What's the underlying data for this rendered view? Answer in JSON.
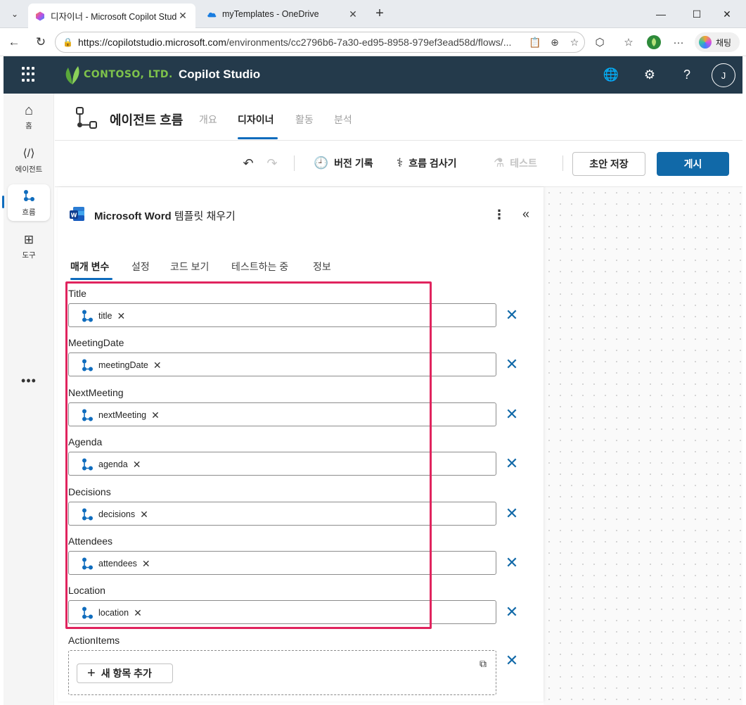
{
  "browser": {
    "tabs": [
      {
        "title": "디자이너 - Microsoft Copilot Studio",
        "active": true
      },
      {
        "title": "myTemplates - OneDrive",
        "active": false
      }
    ],
    "url_host": "https://copilotstudio.microsoft.com",
    "url_path": "/environments/cc2796b6-7a30-ed95-8958-979ef3ead58d/flows/...",
    "copilot_label": "채팅"
  },
  "header": {
    "brand": "CONTOSO, LTD.",
    "app_name": "Copilot Studio",
    "avatar_initial": "J"
  },
  "rail": {
    "items": [
      {
        "label": "홈"
      },
      {
        "label": "에이전트"
      },
      {
        "label": "흐름"
      },
      {
        "label": "도구"
      }
    ],
    "more": "•••"
  },
  "page": {
    "title": "에이전트 흐름",
    "tabs": [
      "개요",
      "디자이너",
      "활동",
      "분석"
    ],
    "active_tab": "디자이너"
  },
  "toolbar": {
    "version_history": "버전 기록",
    "flow_checker": "흐름 검사기",
    "test": "테스트",
    "save_draft": "초안 저장",
    "publish": "게시"
  },
  "panel": {
    "title_bold": "Microsoft Word",
    "title_rest": " 템플릿 채우기",
    "tabs": [
      "매개 변수",
      "설정",
      "코드 보기",
      "테스트하는 중",
      "정보"
    ],
    "fields": [
      {
        "label": "Title",
        "token": "title"
      },
      {
        "label": "MeetingDate",
        "token": "meetingDate"
      },
      {
        "label": "NextMeeting",
        "token": "nextMeeting"
      },
      {
        "label": "Agenda",
        "token": "agenda"
      },
      {
        "label": "Decisions",
        "token": "decisions"
      },
      {
        "label": "Attendees",
        "token": "attendees"
      },
      {
        "label": "Location",
        "token": "location"
      }
    ],
    "array_field": {
      "label": "ActionItems",
      "add_label": "새 항목 추가"
    }
  },
  "colors": {
    "header_bg": "#243a4b",
    "accent": "#1169a8",
    "highlight": "#e0245e",
    "brand_green": "#7ec24b"
  }
}
